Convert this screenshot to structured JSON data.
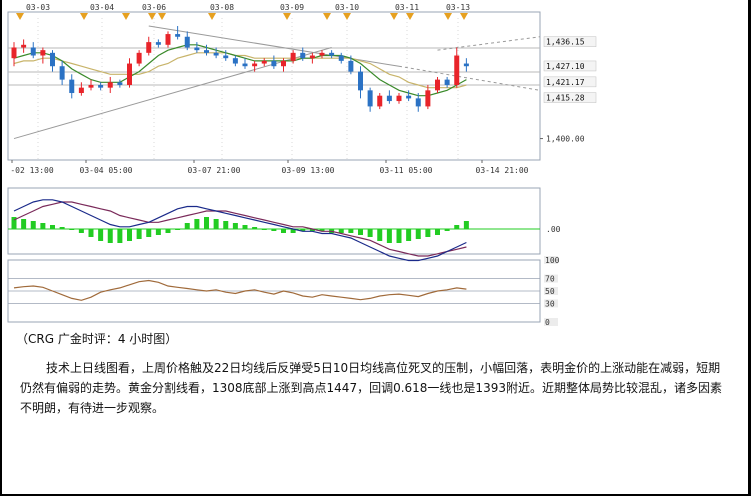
{
  "chart_data": {
    "type": "candlestick",
    "top_dates": [
      "03-03",
      "03-04",
      "03-06",
      "03-08",
      "03-09",
      "03-10",
      "03-11",
      "03-13"
    ],
    "bottom_dates": [
      "-02 13:00",
      "03-04 05:00",
      "03-07 21:00",
      "03-09 13:00",
      "03-11 05:00",
      "03-14 21:00"
    ],
    "price_ylim": [
      1392,
      1445
    ],
    "price_ticks": [
      1400
    ],
    "price_tick_labels": [
      "1,400.00"
    ],
    "price_tags": [
      {
        "label": "1,436.15",
        "value": 1436.15
      },
      {
        "label": "1,427.10",
        "value": 1427.1
      },
      {
        "label": "1,421.17",
        "value": 1421.17
      },
      {
        "label": "1,415.28",
        "value": 1415.28
      }
    ],
    "candles": [
      {
        "o": 1430,
        "h": 1436,
        "l": 1427,
        "c": 1434
      },
      {
        "o": 1434,
        "h": 1437,
        "l": 1432,
        "c": 1435
      },
      {
        "o": 1434,
        "h": 1436,
        "l": 1430,
        "c": 1431
      },
      {
        "o": 1431,
        "h": 1434,
        "l": 1428,
        "c": 1433
      },
      {
        "o": 1432,
        "h": 1433,
        "l": 1425,
        "c": 1427
      },
      {
        "o": 1427,
        "h": 1429,
        "l": 1420,
        "c": 1422
      },
      {
        "o": 1422,
        "h": 1424,
        "l": 1415,
        "c": 1417
      },
      {
        "o": 1417,
        "h": 1421,
        "l": 1416,
        "c": 1419
      },
      {
        "o": 1419,
        "h": 1422,
        "l": 1418,
        "c": 1420
      },
      {
        "o": 1420,
        "h": 1421,
        "l": 1418,
        "c": 1419
      },
      {
        "o": 1419,
        "h": 1423,
        "l": 1417,
        "c": 1421
      },
      {
        "o": 1421,
        "h": 1422,
        "l": 1419,
        "c": 1420
      },
      {
        "o": 1420,
        "h": 1430,
        "l": 1419,
        "c": 1428
      },
      {
        "o": 1428,
        "h": 1433,
        "l": 1427,
        "c": 1432
      },
      {
        "o": 1432,
        "h": 1438,
        "l": 1431,
        "c": 1436
      },
      {
        "o": 1436,
        "h": 1437,
        "l": 1434,
        "c": 1435
      },
      {
        "o": 1435,
        "h": 1440,
        "l": 1434,
        "c": 1439
      },
      {
        "o": 1439,
        "h": 1442,
        "l": 1437,
        "c": 1438
      },
      {
        "o": 1438,
        "h": 1440,
        "l": 1433,
        "c": 1434
      },
      {
        "o": 1434,
        "h": 1436,
        "l": 1432,
        "c": 1433
      },
      {
        "o": 1433,
        "h": 1435,
        "l": 1431,
        "c": 1432
      },
      {
        "o": 1432,
        "h": 1434,
        "l": 1430,
        "c": 1431
      },
      {
        "o": 1431,
        "h": 1433,
        "l": 1429,
        "c": 1430
      },
      {
        "o": 1430,
        "h": 1431,
        "l": 1427,
        "c": 1428
      },
      {
        "o": 1428,
        "h": 1430,
        "l": 1426,
        "c": 1427
      },
      {
        "o": 1427,
        "h": 1429,
        "l": 1425,
        "c": 1428
      },
      {
        "o": 1428,
        "h": 1430,
        "l": 1427,
        "c": 1429
      },
      {
        "o": 1429,
        "h": 1431,
        "l": 1426,
        "c": 1427
      },
      {
        "o": 1427,
        "h": 1430,
        "l": 1425,
        "c": 1429
      },
      {
        "o": 1429,
        "h": 1433,
        "l": 1428,
        "c": 1432
      },
      {
        "o": 1432,
        "h": 1434,
        "l": 1429,
        "c": 1430
      },
      {
        "o": 1430,
        "h": 1432,
        "l": 1428,
        "c": 1431
      },
      {
        "o": 1431,
        "h": 1433,
        "l": 1430,
        "c": 1432
      },
      {
        "o": 1432,
        "h": 1433,
        "l": 1430,
        "c": 1431
      },
      {
        "o": 1431,
        "h": 1432,
        "l": 1428,
        "c": 1429
      },
      {
        "o": 1429,
        "h": 1431,
        "l": 1424,
        "c": 1425
      },
      {
        "o": 1425,
        "h": 1427,
        "l": 1415,
        "c": 1418
      },
      {
        "o": 1418,
        "h": 1419,
        "l": 1410,
        "c": 1412
      },
      {
        "o": 1412,
        "h": 1417,
        "l": 1411,
        "c": 1416
      },
      {
        "o": 1416,
        "h": 1418,
        "l": 1413,
        "c": 1414
      },
      {
        "o": 1414,
        "h": 1417,
        "l": 1413,
        "c": 1416
      },
      {
        "o": 1416,
        "h": 1418,
        "l": 1414,
        "c": 1415
      },
      {
        "o": 1415,
        "h": 1417,
        "l": 1410,
        "c": 1412
      },
      {
        "o": 1412,
        "h": 1420,
        "l": 1411,
        "c": 1418
      },
      {
        "o": 1418,
        "h": 1423,
        "l": 1417,
        "c": 1422
      },
      {
        "o": 1422,
        "h": 1423,
        "l": 1419,
        "c": 1420
      },
      {
        "o": 1420,
        "h": 1434,
        "l": 1419,
        "c": 1431
      },
      {
        "o": 1428,
        "h": 1430,
        "l": 1425,
        "c": 1427
      }
    ],
    "ma_fast": [
      1430,
      1431,
      1432,
      1432,
      1431,
      1429,
      1426,
      1424,
      1422,
      1421,
      1421,
      1421,
      1423,
      1425,
      1428,
      1431,
      1433,
      1434,
      1435,
      1435,
      1434,
      1433,
      1432,
      1431,
      1430,
      1429,
      1429,
      1429,
      1429,
      1429,
      1430,
      1430,
      1431,
      1431,
      1431,
      1430,
      1428,
      1425,
      1422,
      1420,
      1418,
      1417,
      1416,
      1416,
      1417,
      1418,
      1420,
      1422
    ],
    "ma_slow": [
      1428,
      1429,
      1429,
      1430,
      1430,
      1429,
      1428,
      1427,
      1426,
      1425,
      1424,
      1424,
      1424,
      1424,
      1425,
      1427,
      1428,
      1430,
      1431,
      1432,
      1432,
      1432,
      1432,
      1431,
      1431,
      1430,
      1430,
      1430,
      1430,
      1430,
      1430,
      1430,
      1430,
      1430,
      1430,
      1430,
      1429,
      1428,
      1426,
      1424,
      1423,
      1421,
      1420,
      1419,
      1419,
      1419,
      1419,
      1420
    ],
    "macd_histogram": [
      3,
      2.5,
      2,
      1.5,
      1,
      0.5,
      0,
      -1,
      -2,
      -3,
      -3.5,
      -3.5,
      -3,
      -2.5,
      -2,
      -1.5,
      -1,
      0,
      1.5,
      2.5,
      3,
      2.5,
      2,
      1.5,
      1,
      0.5,
      0,
      -0.5,
      -1,
      -1,
      -0.5,
      -0.5,
      -0.5,
      -1,
      -1,
      -1,
      -1.5,
      -2,
      -3,
      -3.5,
      -3.5,
      -3,
      -2.5,
      -2,
      -1.5,
      -0.5,
      1,
      2
    ],
    "macd_line": [
      4,
      5,
      6,
      6.5,
      6.5,
      6,
      5,
      4,
      3,
      2,
      1,
      0.5,
      0.5,
      1,
      1.5,
      2.5,
      3.5,
      4.5,
      5,
      5,
      4.5,
      4,
      3.5,
      3,
      2.5,
      2,
      1.5,
      1,
      0.5,
      0,
      -0.5,
      -0.5,
      -1,
      -1,
      -1.5,
      -2,
      -3,
      -4,
      -5,
      -6,
      -6.5,
      -7,
      -7,
      -6.5,
      -6,
      -5,
      -4,
      -3
    ],
    "macd_signal": [
      2,
      3,
      4,
      5,
      5.5,
      6,
      6,
      5.5,
      5,
      4.5,
      4,
      3,
      2.5,
      2,
      1.5,
      1.5,
      2,
      2.5,
      3,
      3.5,
      4,
      4,
      4,
      3.5,
      3,
      2.5,
      2,
      1.5,
      1,
      0.5,
      0.5,
      0,
      -0.5,
      -0.5,
      -1,
      -1.5,
      -2,
      -2.5,
      -3.5,
      -4.5,
      -5,
      -5.5,
      -6,
      -6,
      -5.5,
      -5,
      -4.5,
      -4
    ],
    "macd_zero_label": ".00",
    "osc_ylim": [
      0,
      100
    ],
    "osc_ticks": [
      100,
      70,
      50,
      30,
      0
    ],
    "osc_tick_labels": [
      "100",
      "70",
      "50",
      "30",
      "0"
    ],
    "osc_line": [
      55,
      57,
      58,
      56,
      50,
      44,
      38,
      35,
      40,
      48,
      52,
      55,
      60,
      65,
      67,
      64,
      58,
      56,
      54,
      52,
      50,
      52,
      48,
      46,
      50,
      52,
      48,
      45,
      50,
      47,
      42,
      40,
      44,
      42,
      40,
      38,
      36,
      38,
      42,
      44,
      45,
      43,
      41,
      46,
      50,
      52,
      55,
      53
    ]
  },
  "caption": "（CRG 广金时评：4 小时图）",
  "commentary": "技术上日线图看，上周价格触及22日均线后反弹受5日10日均线高位死叉的压制，小幅回落，表明金价的上涨动能在减弱，短期仍然有偏弱的走势。黄金分割线看，1308底部上涨到高点1447，回调0.618一线也是1393附近。近期整体局势比较混乱，诸多因素不明朗，有待进一步观察。",
  "colors": {
    "up": "#e8242a",
    "down": "#2b72c4",
    "ma_fast": "#3a8a2a",
    "ma_slow": "#c8b46a",
    "trend": "#9a9a9a",
    "macd_pos": "#22cc22",
    "macd_line": "#1a2a8a",
    "macd_signal": "#7a2a5a",
    "osc": "#a06a3a",
    "marker": "#e6a020"
  }
}
